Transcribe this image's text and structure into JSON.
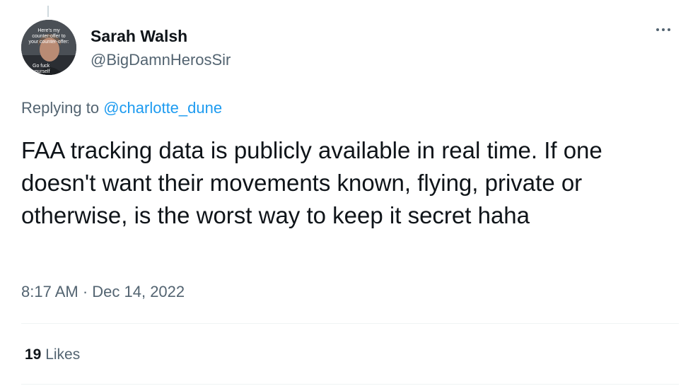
{
  "tweet": {
    "author_name": "Sarah Walsh",
    "author_handle": "@BigDamnHerosSir",
    "avatar_caption_top": "Here's my counter-offer to your counter-offer:",
    "avatar_caption_bottom": "Go fuck yourself",
    "reply_prefix": "Replying to",
    "reply_to": "@charlotte_dune",
    "text": "FAA tracking data is publicly available in real time. If one doesn't want their movements known, flying, private or otherwise, is the worst way to keep it secret haha",
    "timestamp": "8:17 AM · Dec 14, 2022",
    "likes_count": "19",
    "likes_label": "Likes"
  },
  "colors": {
    "link": "#1d9bf0",
    "muted": "#536471",
    "text": "#0f1419"
  },
  "icons": {
    "more": "more-horizontal-icon"
  }
}
